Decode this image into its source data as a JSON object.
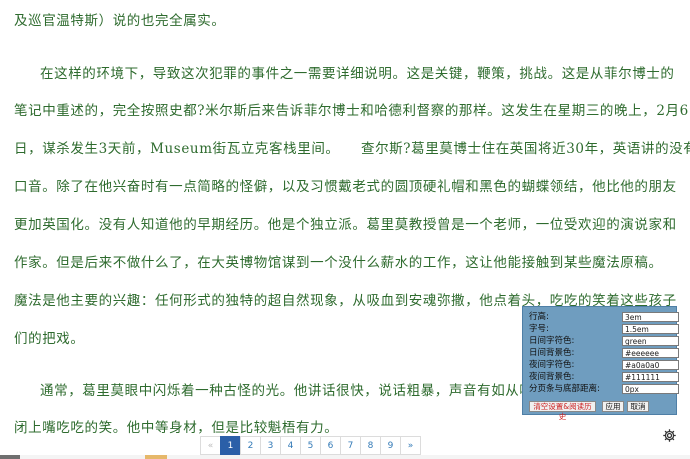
{
  "article": {
    "lines": [
      "及巡官温特斯）说的也完全属实。",
      "在这样的环境下，导致这次犯罪的事件之一需要详细说明。这是关键，鞭策，挑战。这是从菲尔博士的",
      "笔记中重述的，完全按照史都?米尔斯后来告诉菲尔博士和哈德利督察的那样。这发生在星期三的晚上，2月6",
      "日，谋杀发生3天前，Museum街瓦立克客栈里间。　　查尔斯?葛里莫博士住在英国将近30年，英语讲的没有",
      "口音。除了在他兴奋时有一点简略的怪僻，以及习惯戴老式的圆顶硬礼帽和黑色的蝴蝶领结，他比他的朋友",
      "更加英国化。没有人知道他的早期经历。他是个独立派。葛里莫教授曾是一个老师，一位受欢迎的演说家和",
      "作家。但是后来不做什么了，在大英博物馆谋到一个没什么薪水的工作，这让他能接触到某些魔法原稿。",
      "魔法是他主要的兴趣：任何形式的独特的超自然现象，从吸血到安魂弥撒，他点着头，吃吃的笑着这些孩子",
      "们的把戏。",
      "通常，葛里莫眼中闪烁着一种古怪的光。他讲话很快，说话粗暴，声音有如从喉咙深处发出",
      "闭上嘴吃吃的笑。他中等身材，但是比较魁梧有力。"
    ]
  },
  "pagination": {
    "prev": "«",
    "pages": [
      "1",
      "2",
      "3",
      "4",
      "5",
      "6",
      "7",
      "8",
      "9"
    ],
    "current": "1",
    "next": "»"
  },
  "settings": {
    "fields": [
      {
        "label": "行高:",
        "value": "3em"
      },
      {
        "label": "字号:",
        "value": "1.5em"
      },
      {
        "label": "日间字符色:",
        "value": "green"
      },
      {
        "label": "日间背景色:",
        "value": "#eeeeee"
      },
      {
        "label": "夜间字符色:",
        "value": "#a0a0a0"
      },
      {
        "label": "夜间背景色:",
        "value": "#111111"
      },
      {
        "label": "分页条与底部距离:",
        "value": "0px"
      }
    ],
    "clear_label": "清空设置&阅读历史",
    "apply_label": "应用",
    "cancel_label": "取消"
  },
  "icons": {
    "settings_toggle": "gear-icon"
  },
  "colors": {
    "text": "#2e6b2e",
    "panel_bg": "#6f9dbf",
    "active_page": "#2b5fa8",
    "clear_button_text": "#cc2222"
  }
}
